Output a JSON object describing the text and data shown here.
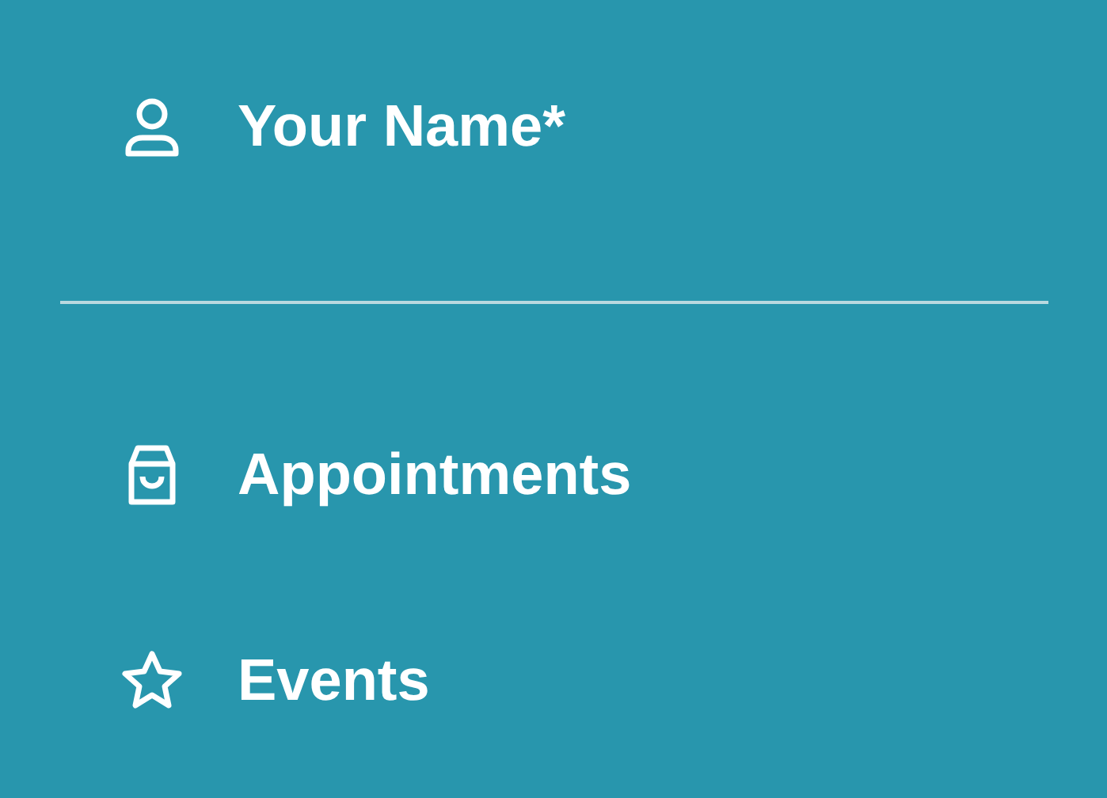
{
  "profile": {
    "label": "Your Name*"
  },
  "menu": [
    {
      "label": "Appointments"
    },
    {
      "label": "Events"
    }
  ]
}
